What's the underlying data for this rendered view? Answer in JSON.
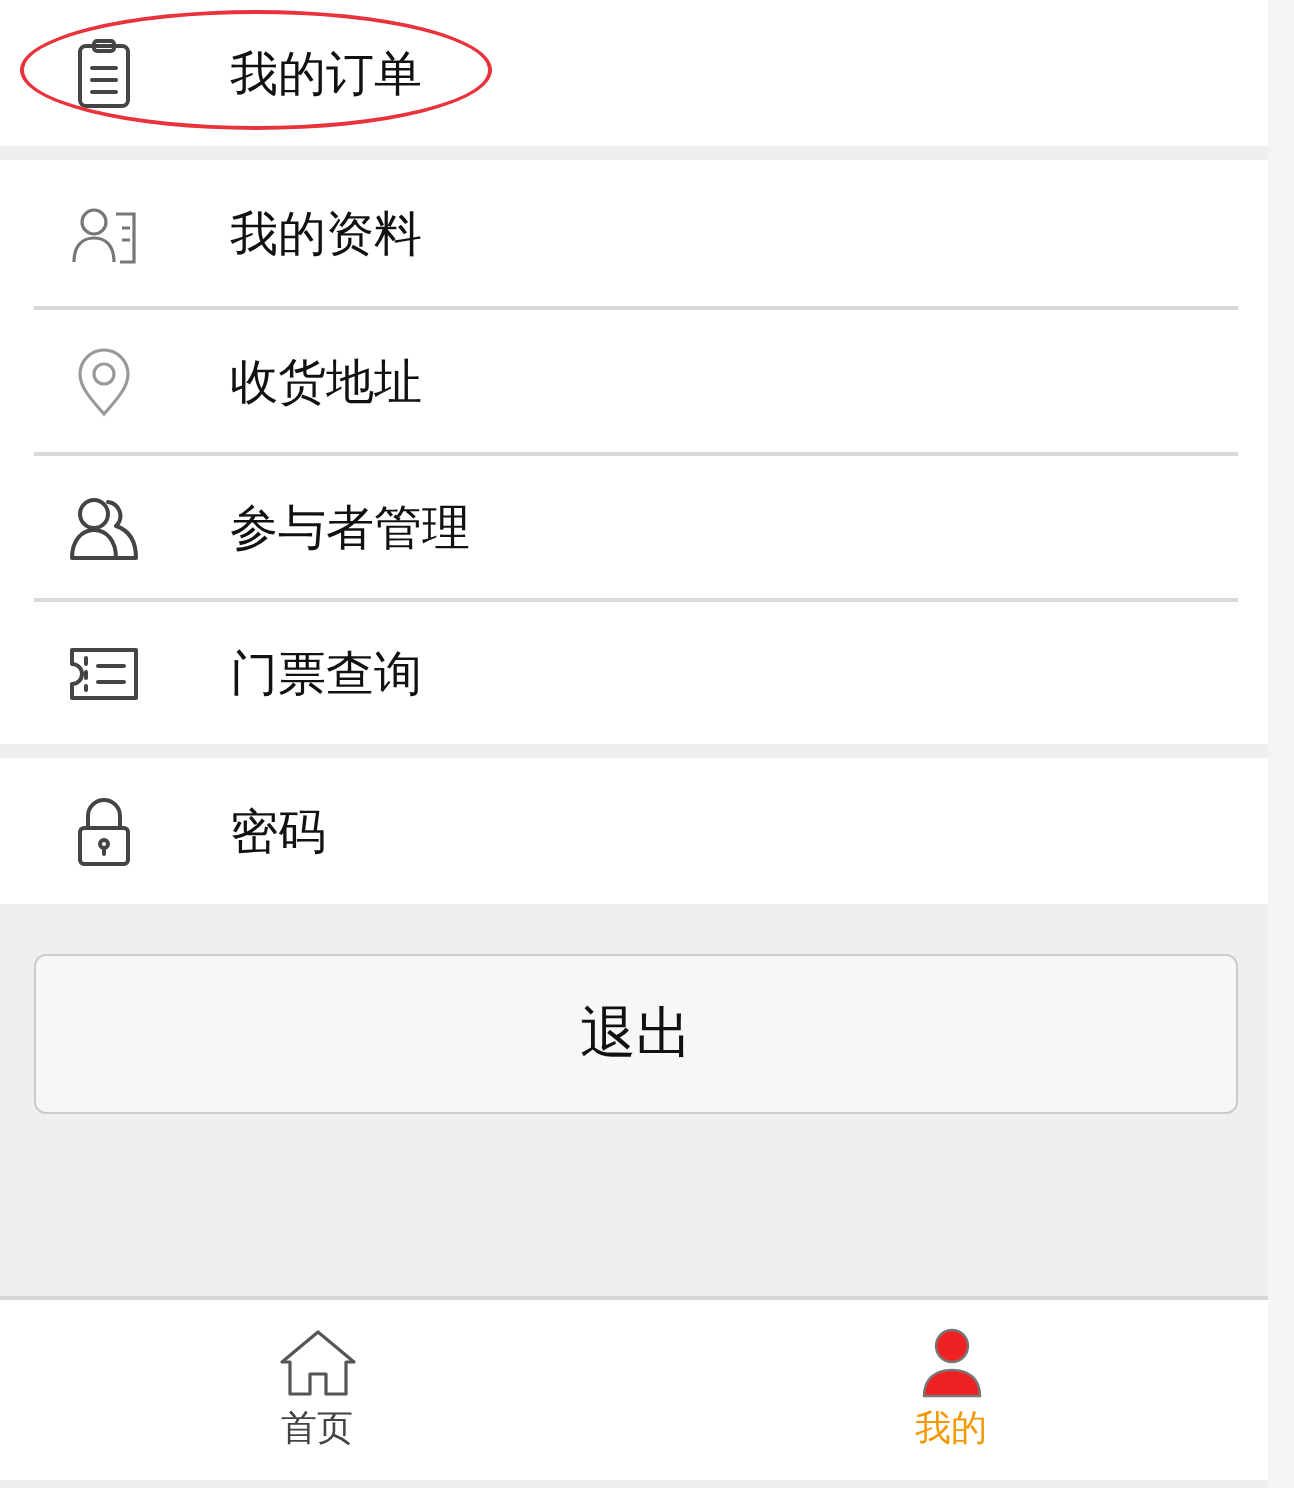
{
  "menu_groups": [
    {
      "items": [
        {
          "label": "我的订单",
          "highlighted": true
        }
      ]
    },
    {
      "items": [
        {
          "label": "我的资料",
          "highlighted": false
        },
        {
          "label": "收货地址",
          "highlighted": false
        },
        {
          "label": "参与者管理",
          "highlighted": false
        },
        {
          "label": "门票查询",
          "highlighted": false
        }
      ]
    },
    {
      "items": [
        {
          "label": "密码",
          "highlighted": false
        }
      ]
    }
  ],
  "logout_button": "退出",
  "tab_bar": [
    {
      "label": "首页",
      "selected": false
    },
    {
      "label": "我的",
      "selected": true
    }
  ]
}
